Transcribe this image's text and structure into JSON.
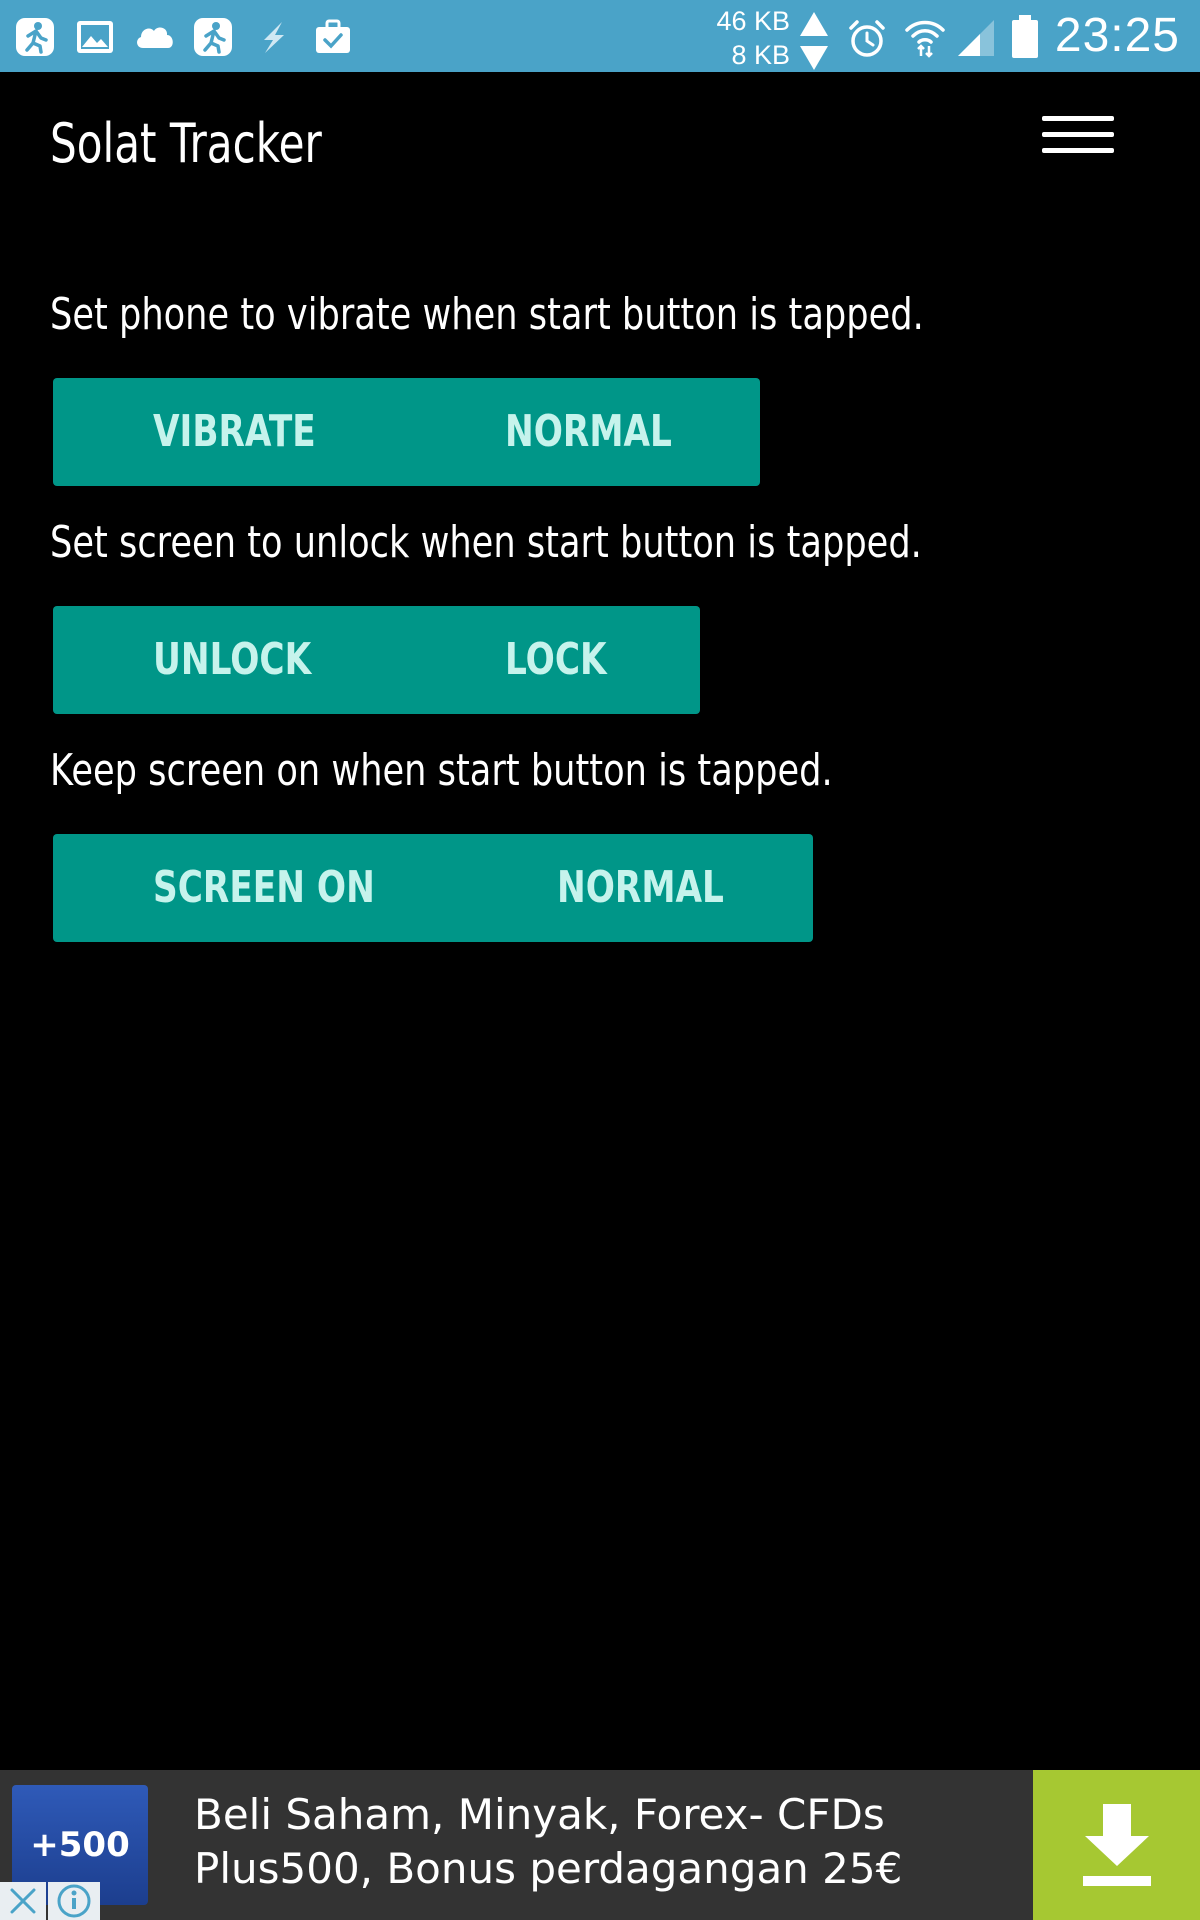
{
  "status_bar": {
    "notification_icons": [
      "running-figure-icon",
      "image-icon",
      "cloud-icon",
      "running-figure-icon",
      "flash-icon",
      "briefcase-check-icon"
    ],
    "upload_speed": "46 KB",
    "download_speed": "8 KB",
    "system_icons": [
      "alarm-clock-icon",
      "wifi-icon",
      "signal-icon",
      "battery-icon"
    ],
    "time": "23:25",
    "background_color": "#4aa3c8"
  },
  "app_bar": {
    "title": "Solat Tracker",
    "menu_icon": "hamburger-menu-icon"
  },
  "settings": [
    {
      "label": "Set phone to vibrate when start button is tapped.",
      "options": [
        "VIBRATE",
        "NORMAL"
      ]
    },
    {
      "label": "Set screen to unlock when start button is tapped.",
      "options": [
        "UNLOCK",
        "LOCK"
      ]
    },
    {
      "label": "Keep screen on when start button is tapped.",
      "options": [
        "SCREEN ON",
        "NORMAL"
      ]
    }
  ],
  "ad": {
    "logo_text": "+500",
    "line1": "Beli Saham, Minyak, Forex- CFDs",
    "line2": "Plus500, Bonus perdagangan 25€",
    "download_icon": "download-icon",
    "close_icon": "close-icon",
    "info_icon": "info-icon",
    "background_color": "#333333",
    "download_color": "#a6c832"
  },
  "colors": {
    "background": "#000000",
    "accent": "#009688",
    "button_text": "#c6f3ec"
  }
}
